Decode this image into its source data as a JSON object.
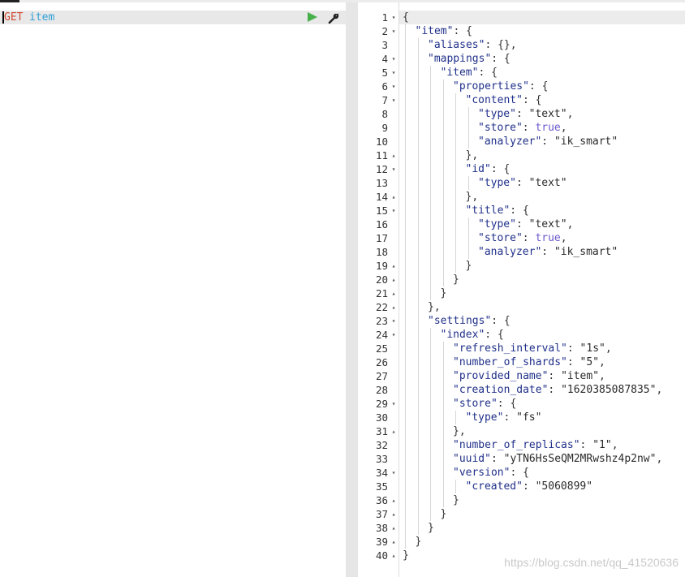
{
  "request": {
    "method": "GET",
    "path": "item"
  },
  "response": {
    "lines": [
      {
        "n": "1",
        "fold": "▾",
        "indent": 0,
        "parts": [
          [
            "p",
            "{"
          ]
        ]
      },
      {
        "n": "2",
        "fold": "▾",
        "indent": 1,
        "parts": [
          [
            "k",
            "\"item\""
          ],
          [
            "p",
            ": {"
          ]
        ]
      },
      {
        "n": "3",
        "fold": "",
        "indent": 2,
        "parts": [
          [
            "k",
            "\"aliases\""
          ],
          [
            "p",
            ": {},"
          ]
        ]
      },
      {
        "n": "4",
        "fold": "▾",
        "indent": 2,
        "parts": [
          [
            "k",
            "\"mappings\""
          ],
          [
            "p",
            ": {"
          ]
        ]
      },
      {
        "n": "5",
        "fold": "▾",
        "indent": 3,
        "parts": [
          [
            "k",
            "\"item\""
          ],
          [
            "p",
            ": {"
          ]
        ]
      },
      {
        "n": "6",
        "fold": "▾",
        "indent": 4,
        "parts": [
          [
            "k",
            "\"properties\""
          ],
          [
            "p",
            ": {"
          ]
        ]
      },
      {
        "n": "7",
        "fold": "▾",
        "indent": 5,
        "parts": [
          [
            "k",
            "\"content\""
          ],
          [
            "p",
            ": {"
          ]
        ]
      },
      {
        "n": "8",
        "fold": "",
        "indent": 6,
        "parts": [
          [
            "k",
            "\"type\""
          ],
          [
            "p",
            ": "
          ],
          [
            "s",
            "\"text\""
          ],
          [
            "p",
            ","
          ]
        ]
      },
      {
        "n": "9",
        "fold": "",
        "indent": 6,
        "parts": [
          [
            "k",
            "\"store\""
          ],
          [
            "p",
            ": "
          ],
          [
            "b",
            "true"
          ],
          [
            "p",
            ","
          ]
        ]
      },
      {
        "n": "10",
        "fold": "",
        "indent": 6,
        "parts": [
          [
            "k",
            "\"analyzer\""
          ],
          [
            "p",
            ": "
          ],
          [
            "s",
            "\"ik_smart\""
          ]
        ]
      },
      {
        "n": "11",
        "fold": "▴",
        "indent": 5,
        "parts": [
          [
            "p",
            "},"
          ]
        ]
      },
      {
        "n": "12",
        "fold": "▾",
        "indent": 5,
        "parts": [
          [
            "k",
            "\"id\""
          ],
          [
            "p",
            ": {"
          ]
        ]
      },
      {
        "n": "13",
        "fold": "",
        "indent": 6,
        "parts": [
          [
            "k",
            "\"type\""
          ],
          [
            "p",
            ": "
          ],
          [
            "s",
            "\"text\""
          ]
        ]
      },
      {
        "n": "14",
        "fold": "▴",
        "indent": 5,
        "parts": [
          [
            "p",
            "},"
          ]
        ]
      },
      {
        "n": "15",
        "fold": "▾",
        "indent": 5,
        "parts": [
          [
            "k",
            "\"title\""
          ],
          [
            "p",
            ": {"
          ]
        ]
      },
      {
        "n": "16",
        "fold": "",
        "indent": 6,
        "parts": [
          [
            "k",
            "\"type\""
          ],
          [
            "p",
            ": "
          ],
          [
            "s",
            "\"text\""
          ],
          [
            "p",
            ","
          ]
        ]
      },
      {
        "n": "17",
        "fold": "",
        "indent": 6,
        "parts": [
          [
            "k",
            "\"store\""
          ],
          [
            "p",
            ": "
          ],
          [
            "b",
            "true"
          ],
          [
            "p",
            ","
          ]
        ]
      },
      {
        "n": "18",
        "fold": "",
        "indent": 6,
        "parts": [
          [
            "k",
            "\"analyzer\""
          ],
          [
            "p",
            ": "
          ],
          [
            "s",
            "\"ik_smart\""
          ]
        ]
      },
      {
        "n": "19",
        "fold": "▴",
        "indent": 5,
        "parts": [
          [
            "p",
            "}"
          ]
        ]
      },
      {
        "n": "20",
        "fold": "▴",
        "indent": 4,
        "parts": [
          [
            "p",
            "}"
          ]
        ]
      },
      {
        "n": "21",
        "fold": "▴",
        "indent": 3,
        "parts": [
          [
            "p",
            "}"
          ]
        ]
      },
      {
        "n": "22",
        "fold": "▴",
        "indent": 2,
        "parts": [
          [
            "p",
            "},"
          ]
        ]
      },
      {
        "n": "23",
        "fold": "▾",
        "indent": 2,
        "parts": [
          [
            "k",
            "\"settings\""
          ],
          [
            "p",
            ": {"
          ]
        ]
      },
      {
        "n": "24",
        "fold": "▾",
        "indent": 3,
        "parts": [
          [
            "k",
            "\"index\""
          ],
          [
            "p",
            ": {"
          ]
        ]
      },
      {
        "n": "25",
        "fold": "",
        "indent": 4,
        "parts": [
          [
            "k",
            "\"refresh_interval\""
          ],
          [
            "p",
            ": "
          ],
          [
            "s",
            "\"1s\""
          ],
          [
            "p",
            ","
          ]
        ]
      },
      {
        "n": "26",
        "fold": "",
        "indent": 4,
        "parts": [
          [
            "k",
            "\"number_of_shards\""
          ],
          [
            "p",
            ": "
          ],
          [
            "s",
            "\"5\""
          ],
          [
            "p",
            ","
          ]
        ]
      },
      {
        "n": "27",
        "fold": "",
        "indent": 4,
        "parts": [
          [
            "k",
            "\"provided_name\""
          ],
          [
            "p",
            ": "
          ],
          [
            "s",
            "\"item\""
          ],
          [
            "p",
            ","
          ]
        ]
      },
      {
        "n": "28",
        "fold": "",
        "indent": 4,
        "parts": [
          [
            "k",
            "\"creation_date\""
          ],
          [
            "p",
            ": "
          ],
          [
            "s",
            "\"1620385087835\""
          ],
          [
            "p",
            ","
          ]
        ]
      },
      {
        "n": "29",
        "fold": "▾",
        "indent": 4,
        "parts": [
          [
            "k",
            "\"store\""
          ],
          [
            "p",
            ": {"
          ]
        ]
      },
      {
        "n": "30",
        "fold": "",
        "indent": 5,
        "parts": [
          [
            "k",
            "\"type\""
          ],
          [
            "p",
            ": "
          ],
          [
            "s",
            "\"fs\""
          ]
        ]
      },
      {
        "n": "31",
        "fold": "▴",
        "indent": 4,
        "parts": [
          [
            "p",
            "},"
          ]
        ]
      },
      {
        "n": "32",
        "fold": "",
        "indent": 4,
        "parts": [
          [
            "k",
            "\"number_of_replicas\""
          ],
          [
            "p",
            ": "
          ],
          [
            "s",
            "\"1\""
          ],
          [
            "p",
            ","
          ]
        ]
      },
      {
        "n": "33",
        "fold": "",
        "indent": 4,
        "parts": [
          [
            "k",
            "\"uuid\""
          ],
          [
            "p",
            ": "
          ],
          [
            "s",
            "\"yTN6HsSeQM2MRwshz4p2nw\""
          ],
          [
            "p",
            ","
          ]
        ]
      },
      {
        "n": "34",
        "fold": "▾",
        "indent": 4,
        "parts": [
          [
            "k",
            "\"version\""
          ],
          [
            "p",
            ": {"
          ]
        ]
      },
      {
        "n": "35",
        "fold": "",
        "indent": 5,
        "parts": [
          [
            "k",
            "\"created\""
          ],
          [
            "p",
            ": "
          ],
          [
            "s",
            "\"5060899\""
          ]
        ]
      },
      {
        "n": "36",
        "fold": "▴",
        "indent": 4,
        "parts": [
          [
            "p",
            "}"
          ]
        ]
      },
      {
        "n": "37",
        "fold": "▴",
        "indent": 3,
        "parts": [
          [
            "p",
            "}"
          ]
        ]
      },
      {
        "n": "38",
        "fold": "▴",
        "indent": 2,
        "parts": [
          [
            "p",
            "}"
          ]
        ]
      },
      {
        "n": "39",
        "fold": "▴",
        "indent": 1,
        "parts": [
          [
            "p",
            "}"
          ]
        ]
      },
      {
        "n": "40",
        "fold": "▴",
        "indent": 0,
        "parts": [
          [
            "p",
            "}"
          ]
        ]
      }
    ]
  },
  "watermark": "https://blog.csdn.net/qq_41520636",
  "colors": {
    "method": "#d14a36",
    "path": "#2f9fd6",
    "run": "#46b04a",
    "keys": "#20308a",
    "bool": "#6a5acd"
  },
  "icons": {
    "run": "play-icon",
    "settings": "wrench-icon"
  }
}
